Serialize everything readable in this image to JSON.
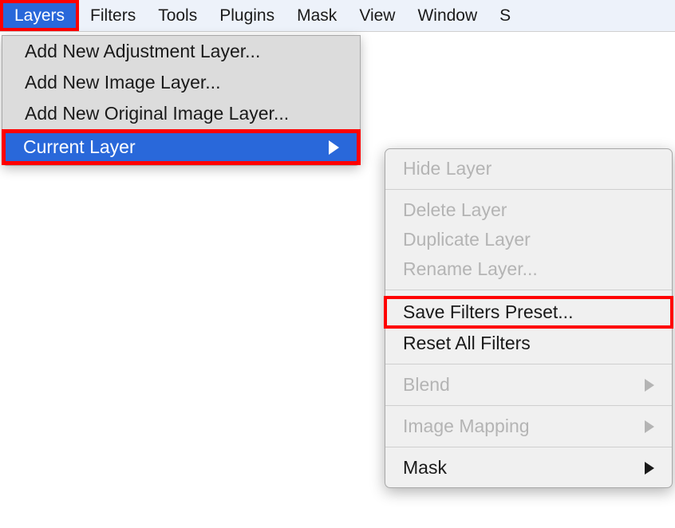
{
  "menubar": {
    "items": [
      {
        "label": "Layers",
        "active": true
      },
      {
        "label": "Filters"
      },
      {
        "label": "Tools"
      },
      {
        "label": "Plugins"
      },
      {
        "label": "Mask"
      },
      {
        "label": "View"
      },
      {
        "label": "Window"
      },
      {
        "label": "S"
      }
    ]
  },
  "dropdown": {
    "items": [
      {
        "label": "Add New Adjustment Layer..."
      },
      {
        "label": "Add New Image Layer..."
      },
      {
        "label": "Add New Original Image Layer..."
      },
      {
        "label": "Current Layer",
        "submenu": true,
        "highlighted": true
      }
    ]
  },
  "submenu": {
    "groups": [
      [
        {
          "label": "Hide Layer",
          "state": "disabled"
        }
      ],
      [
        {
          "label": "Delete Layer",
          "state": "disabled"
        },
        {
          "label": "Duplicate Layer",
          "state": "disabled"
        },
        {
          "label": "Rename Layer...",
          "state": "disabled"
        }
      ],
      [
        {
          "label": "Save Filters Preset...",
          "state": "enabled",
          "boxed": true
        },
        {
          "label": "Reset All Filters",
          "state": "enabled"
        }
      ],
      [
        {
          "label": "Blend",
          "state": "disabled",
          "submenu": true
        }
      ],
      [
        {
          "label": "Image Mapping",
          "state": "disabled",
          "submenu": true
        }
      ],
      [
        {
          "label": "Mask",
          "state": "enabled",
          "submenu": true
        }
      ]
    ]
  }
}
